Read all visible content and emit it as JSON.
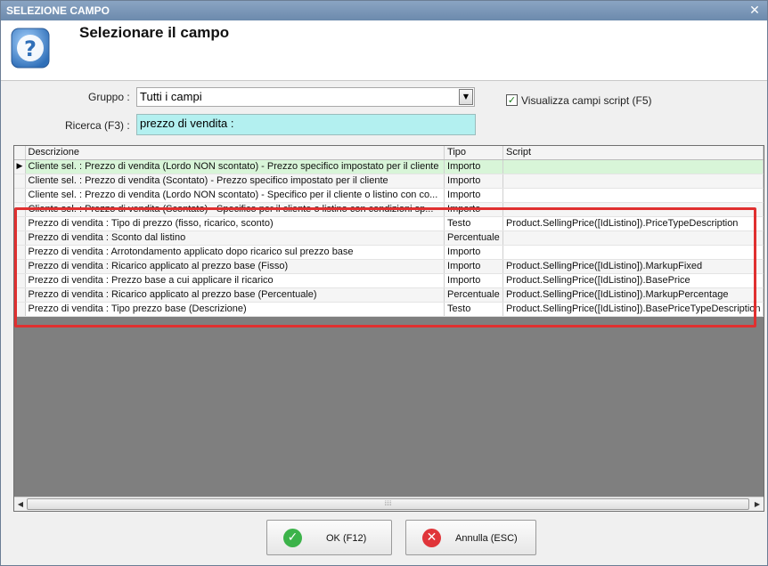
{
  "window": {
    "title": "SELEZIONE CAMPO",
    "close_glyph": "✕"
  },
  "header": {
    "title": "Selezionare il campo",
    "icon": "help-icon"
  },
  "form": {
    "gruppo_label": "Gruppo :",
    "gruppo_value": "Tutti i campi",
    "ricerca_label": "Ricerca (F3) :",
    "ricerca_value": "prezzo di vendita :",
    "script_checkbox_label": "Visualizza campi script (F5)",
    "script_checkbox_checked": true
  },
  "grid": {
    "columns": [
      "Descrizione",
      "Tipo",
      "Script"
    ],
    "rows": [
      {
        "descrizione": "Cliente sel. : Prezzo di vendita (Lordo NON scontato) - Prezzo specifico impostato per il cliente",
        "tipo": "Importo",
        "script": ""
      },
      {
        "descrizione": "Cliente sel. : Prezzo di vendita (Scontato) - Prezzo specifico impostato per il cliente",
        "tipo": "Importo",
        "script": ""
      },
      {
        "descrizione": "Cliente sel. : Prezzo di vendita (Lordo NON scontato) - Specifico per il cliente o listino con co...",
        "tipo": "Importo",
        "script": ""
      },
      {
        "descrizione": "Cliente sel. : Prezzo di vendita (Scontato) - Specifico per il cliente o listino con condizioni sp...",
        "tipo": "Importo",
        "script": ""
      },
      {
        "descrizione": "Prezzo di vendita : Tipo di prezzo (fisso, ricarico, sconto)",
        "tipo": "Testo",
        "script": "Product.SellingPrice([IdListino]).PriceTypeDescription"
      },
      {
        "descrizione": "Prezzo di vendita : Sconto dal listino",
        "tipo": "Percentuale",
        "script": ""
      },
      {
        "descrizione": "Prezzo di vendita : Arrotondamento applicato dopo ricarico sul prezzo base",
        "tipo": "Importo",
        "script": ""
      },
      {
        "descrizione": "Prezzo di vendita : Ricarico applicato al prezzo base (Fisso)",
        "tipo": "Importo",
        "script": "Product.SellingPrice([IdListino]).MarkupFixed"
      },
      {
        "descrizione": "Prezzo di vendita : Prezzo base a cui applicare il ricarico",
        "tipo": "Importo",
        "script": "Product.SellingPrice([IdListino]).BasePrice"
      },
      {
        "descrizione": "Prezzo di vendita : Ricarico applicato al prezzo base (Percentuale)",
        "tipo": "Percentuale",
        "script": "Product.SellingPrice([IdListino]).MarkupPercentage"
      },
      {
        "descrizione": "Prezzo di vendita : Tipo prezzo base (Descrizione)",
        "tipo": "Testo",
        "script": "Product.SellingPrice([IdListino]).BasePriceTypeDescription"
      }
    ],
    "selected_row": 0
  },
  "buttons": {
    "ok_label": "OK (F12)",
    "cancel_label": "Annulla (ESC)"
  },
  "colors": {
    "selected_row": "#d8f5d8",
    "search_bg": "#b3f0f0",
    "highlight_box": "#e03030",
    "ok_icon": "#3cb34a",
    "cancel_icon": "#e0353a"
  }
}
